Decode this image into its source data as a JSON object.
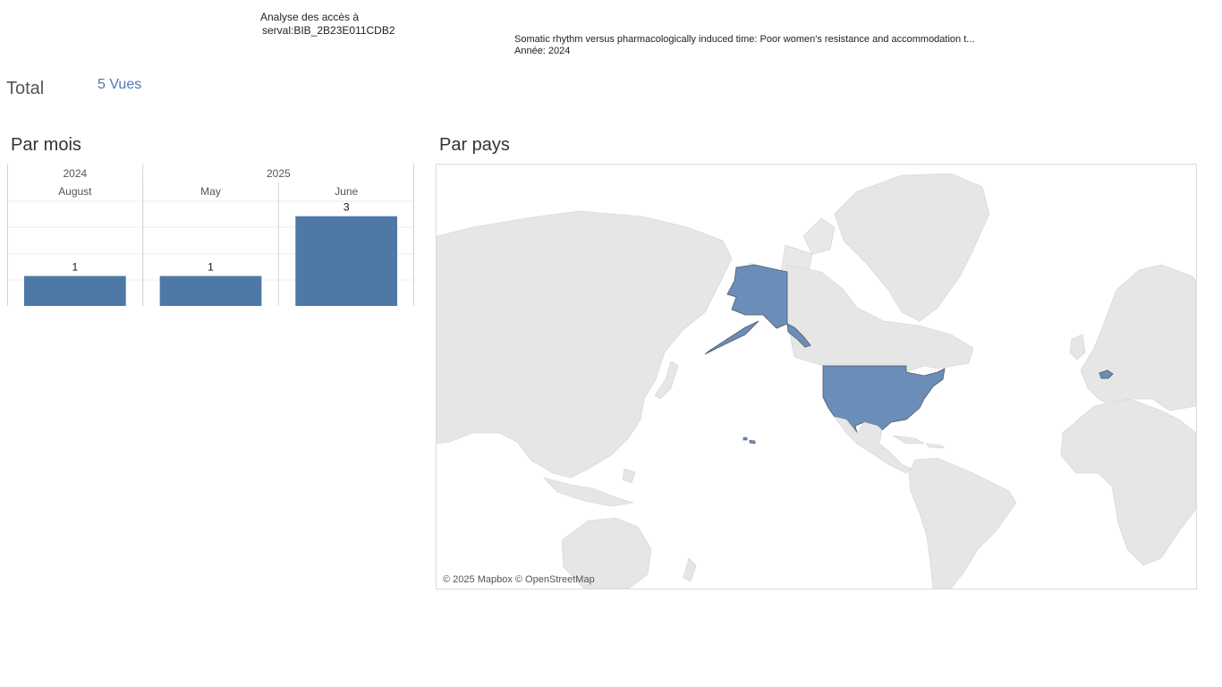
{
  "header": {
    "title_line1": "Analyse des accès à",
    "title_line2": "serval:BIB_2B23E011CDB2"
  },
  "document": {
    "title": "Somatic rhythm versus pharmacologically induced time: Poor women's resistance and accommodation t...",
    "year": "Année: 2024"
  },
  "total": {
    "label": "Total",
    "value": "5 Vues"
  },
  "sections": {
    "by_month": "Par mois",
    "by_country": "Par pays"
  },
  "chart_data": {
    "type": "bar",
    "years": [
      {
        "label": "2024",
        "span": 1
      },
      {
        "label": "2025",
        "span": 2
      }
    ],
    "categories": [
      "August",
      "May",
      "June"
    ],
    "values": [
      1,
      1,
      3
    ],
    "ylim": [
      0,
      3.5
    ],
    "bar_color": "#4e79a7",
    "grid": true
  },
  "map": {
    "attribution": "© 2025 Mapbox © OpenStreetMap",
    "highlighted_countries": [
      "United States",
      "Switzerland"
    ],
    "highlight_color": "#6b8eb8",
    "land_color": "#e6e6e6"
  }
}
